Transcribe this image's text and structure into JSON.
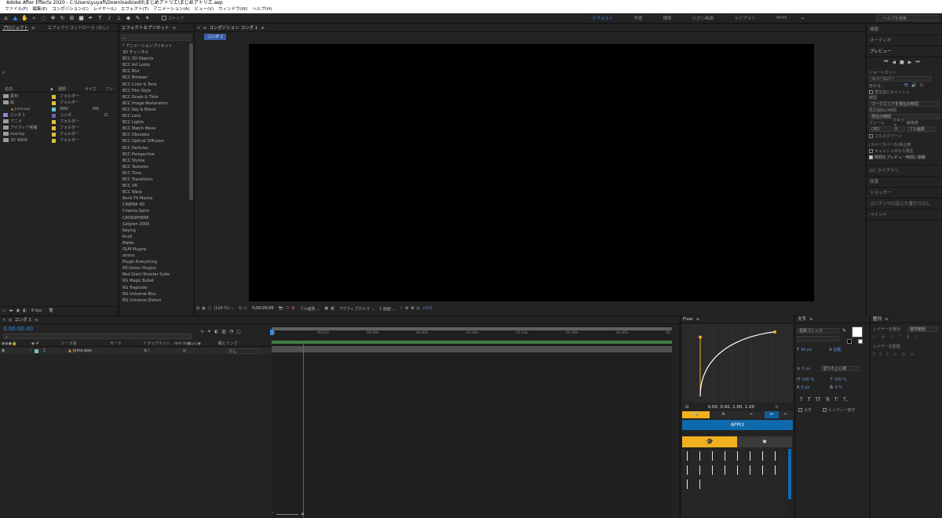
{
  "window": {
    "title": "Adobe After Effects 2020 - C:\\Users\\yuyafi\\Downloads\\edit\\まじめアトリエ\\まじめアトリエ.aep"
  },
  "menu": [
    "ファイル(F)",
    "編集(E)",
    "コンポジション(C)",
    "レイヤー(L)",
    "エフェクト(T)",
    "アニメーション(A)",
    "ビュー(V)",
    "ウィンドウ(W)",
    "ヘルプ(H)"
  ],
  "toolbar": {
    "snap_label": "スナップ",
    "search_placeholder": "ヘルプを検索"
  },
  "workspaces": [
    "デフォルト",
    "学習",
    "標準",
    "小さい画面",
    "ライブラリ",
    "4545"
  ],
  "project": {
    "tab": "プロジェクト",
    "tab2": "エフェクトコントロール (なし)",
    "search_icon": "search-icon",
    "columns": {
      "name": "名前",
      "type": "種類",
      "size": "サイズ",
      "rate": "フレ"
    },
    "items": [
      {
        "name": "素材",
        "type": "フォルダー",
        "size": ""
      },
      {
        "name": "曲",
        "type": "フォルダー",
        "size": ""
      },
      {
        "name": "Jumo.wav",
        "type": "WAV",
        "size": "MB"
      },
      {
        "name": "コンポ 1",
        "type": "コンポ",
        "size": "21"
      },
      {
        "name": "アニメ",
        "type": "フォルダー",
        "size": ""
      },
      {
        "name": "アイディア候補",
        "type": "フォルダー",
        "size": ""
      },
      {
        "name": "overlay",
        "type": "フォルダー",
        "size": ""
      },
      {
        "name": "3D MAYA",
        "type": "フォルダー",
        "size": ""
      }
    ],
    "bpc": "8 bpc"
  },
  "effects": {
    "tab": "エフェクト＆プリセット",
    "items": [
      "* アニメーションプリセット",
      "3D チャンネル",
      "BCC 3D Objects",
      "BCC Art Looks",
      "BCC Blur",
      "BCC Browser",
      "BCC Color & Tone",
      "BCC Film Style",
      "BCC Grads & Tints",
      "BCC Image Restoration",
      "BCC Key & Blend",
      "BCC Lens",
      "BCC Lights",
      "BCC Match Move",
      "BCC Obsolete",
      "BCC Optical Diffusion",
      "BCC Particles",
      "BCC Perspective",
      "BCC Stylize",
      "BCC Textures",
      "BCC Time",
      "BCC Transitions",
      "BCC VR",
      "BCC Warp",
      "Boris FX Mocha",
      "CINEMA 4D",
      "Cinema Spice",
      "CROSSPHERE",
      "Gelgren 2000",
      "Keying",
      "Knoll",
      "Matte",
      "OLM Plugins",
      "omino",
      "Plugin Everything",
      "RE:Vision Plugins",
      "Red Giant Shooter Suite",
      "RG Magic Bullet",
      "RG Trapcode",
      "RG Universe Blur",
      "RG Universe Distort"
    ]
  },
  "composition": {
    "tab": "コンポジション コンポ 1",
    "subtab": "コンポ 1",
    "zoom": "124 %",
    "timecode": "0;00;09;06",
    "quality": "フル画質",
    "camera": "アクティブカメラ",
    "views": "1 画面",
    "offset": "+0.0"
  },
  "right_panel": {
    "info": "情報",
    "audio": "オーディオ",
    "preview": "プレビュー",
    "shortcut_label": "ショートカット",
    "shortcut_value": "スペースバー",
    "include_label": "含める：",
    "cache_label": "再生前にキャッシュ",
    "range_label": "範囲",
    "range_value": "ワークエリアを現在の時間",
    "start_label": "再生開始の時間",
    "start_value": "現在の時間",
    "frame_label": "フレーム",
    "skip_label": "スキップ",
    "res_label": "解像度",
    "frame_value": "(30)",
    "skip_value": "0",
    "res_value": "フル画質",
    "fullscreen": "フルスクリーン",
    "stop_label": "(スペースバーの)停止時",
    "cache_opt": "キャッシュ中なら再生",
    "time_opt": "時間をプレビュー時間に移動",
    "items": [
      "CC ライブラリ",
      "段落",
      "トラッカー",
      "コンテンツに応じた塗りつぶし",
      "ペイント"
    ]
  },
  "timeline": {
    "tab": "コンポ 1",
    "timecode": "0:00:00:00",
    "columns": {
      "source": "ソース名",
      "mode": "モード",
      "trkmat": "トラックマット",
      "parent": "親とリンク"
    },
    "layer": {
      "index": "1",
      "name": "Jumo.wav",
      "parent": "なし"
    },
    "ticks": [
      "0s",
      "00:15s",
      "00:30s",
      "00:45s",
      "01:00s",
      "01:15s",
      "01:30s",
      "01:45s",
      "02:"
    ]
  },
  "flow": {
    "tab": "Flow",
    "values": "0.00, 0.92, 1.00, 1.00",
    "apply": "APPLY",
    "curve": [
      0,
      0.92,
      1,
      1
    ]
  },
  "character": {
    "tab": "文字",
    "font": "源柔ゴシック",
    "size": "96 px",
    "auto": "自動",
    "leading_label": "0 px",
    "fill": "塗りの上に線",
    "vscale": "100 %",
    "hscale": "100 %",
    "baseline": "0 px",
    "tsume": "0 %",
    "options": [
      "合字",
      "ヒンディー数字"
    ],
    "typeglyphs": [
      "T",
      "T",
      "TT",
      "Tr",
      "T'",
      "T,"
    ]
  },
  "align": {
    "tab": "整列",
    "align_to": "レイヤーを整列",
    "select": "選択範囲",
    "distribute": "レイヤーを配置"
  }
}
